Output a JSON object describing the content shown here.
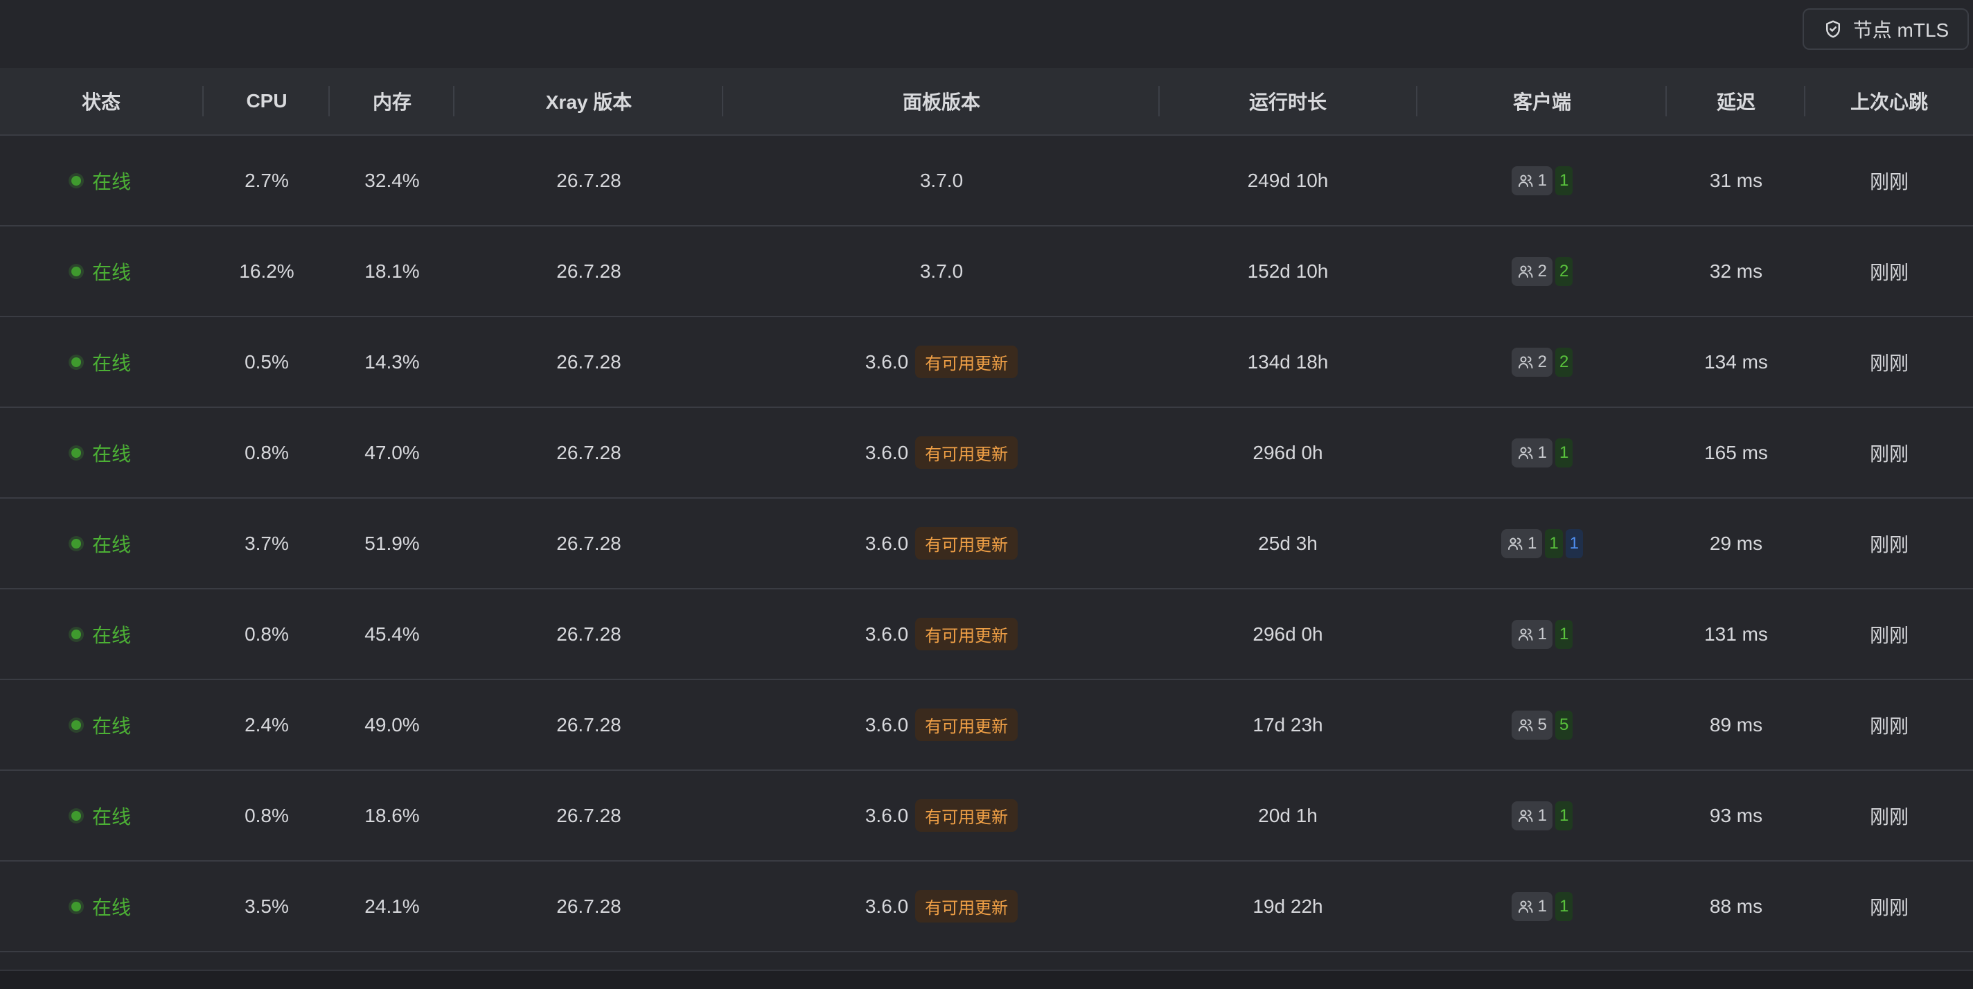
{
  "toolbar": {
    "mtls_label": "节点 mTLS"
  },
  "table": {
    "headers": {
      "status": "状态",
      "cpu": "CPU",
      "memory": "内存",
      "xray": "Xray 版本",
      "panel": "面板版本",
      "uptime": "运行时长",
      "clients": "客户端",
      "latency": "延迟",
      "heartbeat": "上次心跳"
    },
    "rows": [
      {
        "status": "在线",
        "cpu": "2.7%",
        "memory": "32.4%",
        "xray": "26.7.28",
        "panel": "3.7.0",
        "update": "",
        "uptime": "249d 10h",
        "clients_total": "1",
        "clients_online": "1",
        "clients_extra": "",
        "latency": "31 ms",
        "heartbeat": "刚刚"
      },
      {
        "status": "在线",
        "cpu": "16.2%",
        "memory": "18.1%",
        "xray": "26.7.28",
        "panel": "3.7.0",
        "update": "",
        "uptime": "152d 10h",
        "clients_total": "2",
        "clients_online": "2",
        "clients_extra": "",
        "latency": "32 ms",
        "heartbeat": "刚刚"
      },
      {
        "status": "在线",
        "cpu": "0.5%",
        "memory": "14.3%",
        "xray": "26.7.28",
        "panel": "3.6.0",
        "update": "有可用更新",
        "uptime": "134d 18h",
        "clients_total": "2",
        "clients_online": "2",
        "clients_extra": "",
        "latency": "134 ms",
        "heartbeat": "刚刚"
      },
      {
        "status": "在线",
        "cpu": "0.8%",
        "memory": "47.0%",
        "xray": "26.7.28",
        "panel": "3.6.0",
        "update": "有可用更新",
        "uptime": "296d 0h",
        "clients_total": "1",
        "clients_online": "1",
        "clients_extra": "",
        "latency": "165 ms",
        "heartbeat": "刚刚"
      },
      {
        "status": "在线",
        "cpu": "3.7%",
        "memory": "51.9%",
        "xray": "26.7.28",
        "panel": "3.6.0",
        "update": "有可用更新",
        "uptime": "25d 3h",
        "clients_total": "1",
        "clients_online": "1",
        "clients_extra": "1",
        "latency": "29 ms",
        "heartbeat": "刚刚"
      },
      {
        "status": "在线",
        "cpu": "0.8%",
        "memory": "45.4%",
        "xray": "26.7.28",
        "panel": "3.6.0",
        "update": "有可用更新",
        "uptime": "296d 0h",
        "clients_total": "1",
        "clients_online": "1",
        "clients_extra": "",
        "latency": "131 ms",
        "heartbeat": "刚刚"
      },
      {
        "status": "在线",
        "cpu": "2.4%",
        "memory": "49.0%",
        "xray": "26.7.28",
        "panel": "3.6.0",
        "update": "有可用更新",
        "uptime": "17d 23h",
        "clients_total": "5",
        "clients_online": "5",
        "clients_extra": "",
        "latency": "89 ms",
        "heartbeat": "刚刚"
      },
      {
        "status": "在线",
        "cpu": "0.8%",
        "memory": "18.6%",
        "xray": "26.7.28",
        "panel": "3.6.0",
        "update": "有可用更新",
        "uptime": "20d 1h",
        "clients_total": "1",
        "clients_online": "1",
        "clients_extra": "",
        "latency": "93 ms",
        "heartbeat": "刚刚"
      },
      {
        "status": "在线",
        "cpu": "3.5%",
        "memory": "24.1%",
        "xray": "26.7.28",
        "panel": "3.6.0",
        "update": "有可用更新",
        "uptime": "19d 22h",
        "clients_total": "1",
        "clients_online": "1",
        "clients_extra": "",
        "latency": "88 ms",
        "heartbeat": "刚刚"
      }
    ]
  },
  "icons": {
    "mtls": "shield-check-icon",
    "clients": "users-icon"
  },
  "colors": {
    "online": "#4cb035",
    "update": "#f0a046",
    "accent_blue": "#4f8ef0"
  }
}
